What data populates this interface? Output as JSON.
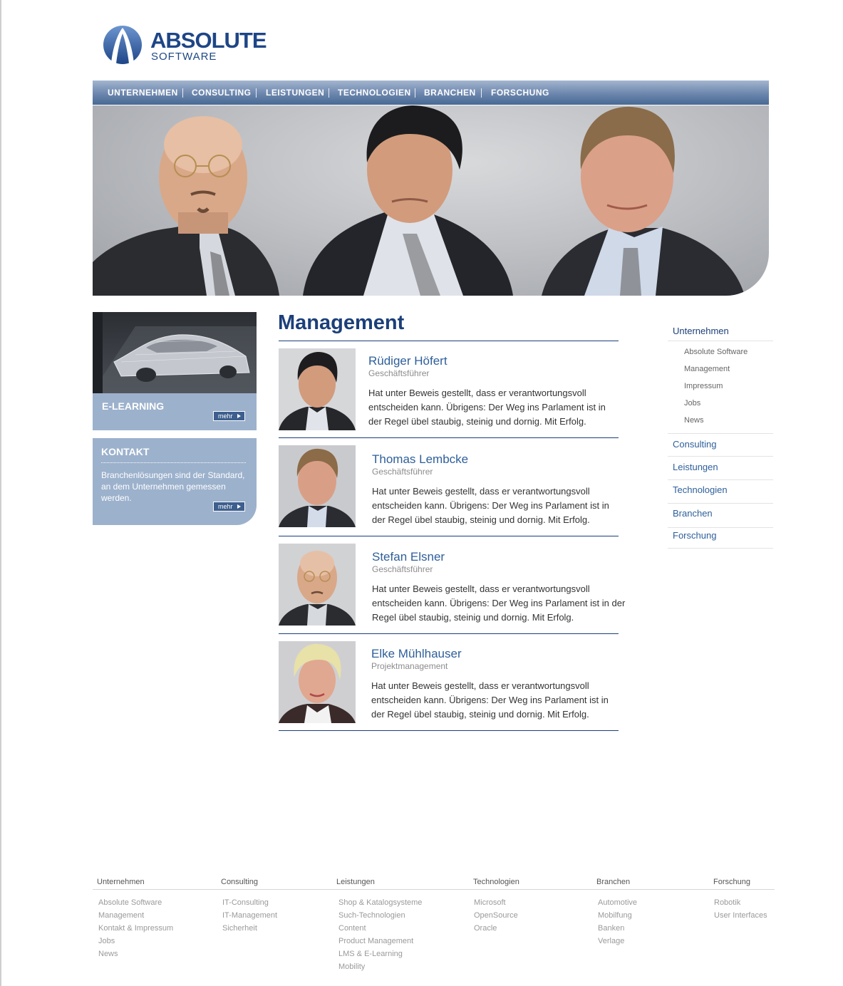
{
  "brand": {
    "title": "ABSOLUTE",
    "subtitle": "SOFTWARE",
    "color": "#1e4687"
  },
  "nav": {
    "items": [
      "UNTERNEHMEN",
      "CONSULTING",
      "LEISTUNGEN",
      "TECHNOLOGIEN",
      "BRANCHEN",
      "FORSCHUNG"
    ]
  },
  "sidebar": {
    "elearning": {
      "title": "E-LEARNING",
      "button": "mehr"
    },
    "kontakt": {
      "title": "KONTAKT",
      "text": "Branchenlösungen sind der Standard, an dem Unternehmen gemessen werden.",
      "button": "mehr"
    }
  },
  "main": {
    "title": "Management",
    "people": [
      {
        "name": "Rüdiger Höfert",
        "role": "Geschäftsführer",
        "text": "Hat unter Beweis gestellt, dass er verantwortungsvoll entscheiden kann. Übrigens:  Der Weg ins Parlament ist in der Regel übel staubig, steinig und dornig.  Mit Erfolg."
      },
      {
        "name": "Thomas Lembcke",
        "role": "Geschäftsführer",
        "text": "Hat unter Beweis gestellt, dass er verantwortungsvoll entscheiden kann. Übrigens:  Der Weg ins Parlament ist in der Regel übel staubig, steinig und dornig.  Mit Erfolg."
      },
      {
        "name": "Stefan Elsner",
        "role": "Geschäftsführer",
        "text": "Hat unter Beweis gestellt, dass er verantwortungsvoll entscheiden kann. Übrigens:  Der Weg ins Parlament ist in der Regel übel staubig, steinig und dornig.  Mit Erfolg."
      },
      {
        "name": "Elke Mühlhauser",
        "role": "Projektmanagement",
        "text": "Hat unter Beweis gestellt, dass er verantwortungsvoll entscheiden kann. Übrigens:  Der Weg ins Parlament ist in der Regel übel staubig, steinig und dornig.  Mit Erfolg."
      }
    ]
  },
  "rightnav": {
    "active": "Unternehmen",
    "subitems": [
      "Absolute Software",
      "Management",
      "Impressum",
      "Jobs",
      "News"
    ],
    "items": [
      "Consulting",
      "Leistungen",
      "Technologien",
      "Branchen",
      "Forschung"
    ]
  },
  "footer": {
    "columns": [
      {
        "title": "Unternehmen",
        "items": [
          "Absolute Software",
          "Management",
          "Kontakt & Impressum",
          "Jobs",
          "News"
        ]
      },
      {
        "title": "Consulting",
        "items": [
          "IT-Consulting",
          "IT-Management",
          "Sicherheit"
        ]
      },
      {
        "title": "Leistungen",
        "items": [
          "Shop & Katalogsysteme",
          "Such-Technologien",
          "Content",
          "Product Management",
          "LMS & E-Learning",
          "Mobility"
        ]
      },
      {
        "title": "Technologien",
        "items": [
          "Microsoft",
          "OpenSource",
          "Oracle"
        ]
      },
      {
        "title": "Branchen",
        "items": [
          "Automotive",
          "Mobilfung",
          "Banken",
          "Verlage"
        ]
      },
      {
        "title": "Forschung",
        "items": [
          "Robotik",
          "User Interfaces"
        ]
      }
    ]
  }
}
